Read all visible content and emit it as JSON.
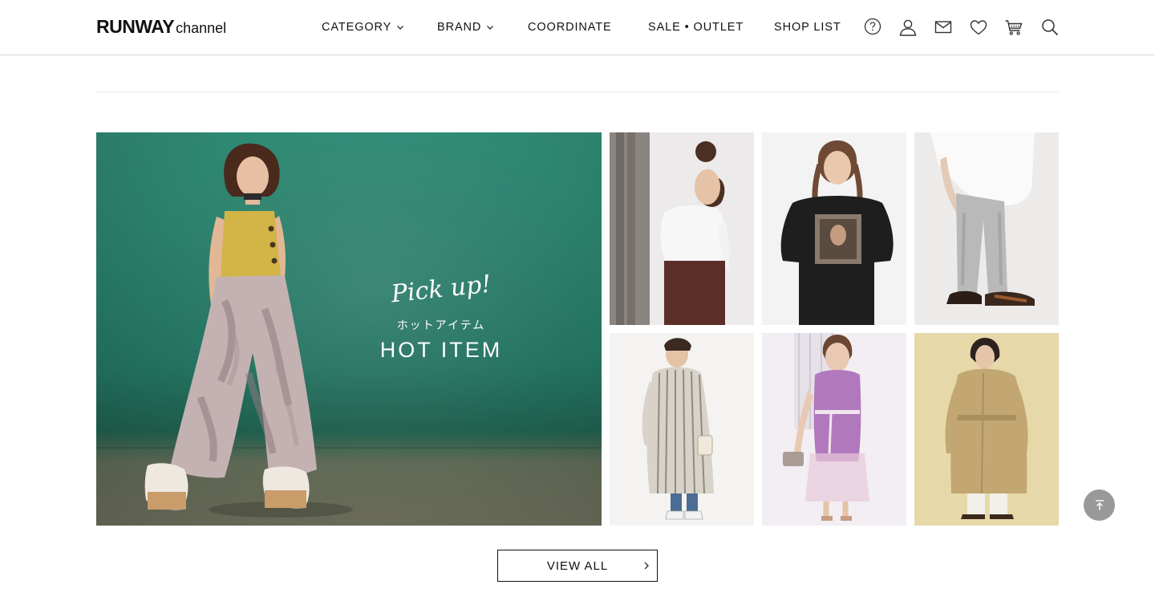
{
  "header": {
    "logo_main": "RUNWAY",
    "logo_sub": "channel",
    "nav": {
      "category": "CATEGORY",
      "brand": "BRAND",
      "coordinate": "COORDINATE",
      "sale_outlet": "SALE • OUTLET",
      "shop_list": "SHOP LIST"
    },
    "icons": [
      "help-icon",
      "user-icon",
      "mail-icon",
      "heart-icon",
      "cart-icon",
      "search-icon"
    ]
  },
  "hero": {
    "pickup_text": "Pick up!",
    "kana_text": "ホットアイテム",
    "hot_item_text": "HOT ITEM",
    "background_color": "#2f8a74"
  },
  "thumbnails": [
    "model-white-sweater-brown-skirt",
    "model-black-photo-tshirt",
    "model-white-top-grey-pants",
    "model-striped-long-dress",
    "model-purple-knit-dress",
    "model-beige-trench-coat"
  ],
  "view_all_label": "VIEW ALL",
  "back_to_top_icon": "arrow-up-icon"
}
